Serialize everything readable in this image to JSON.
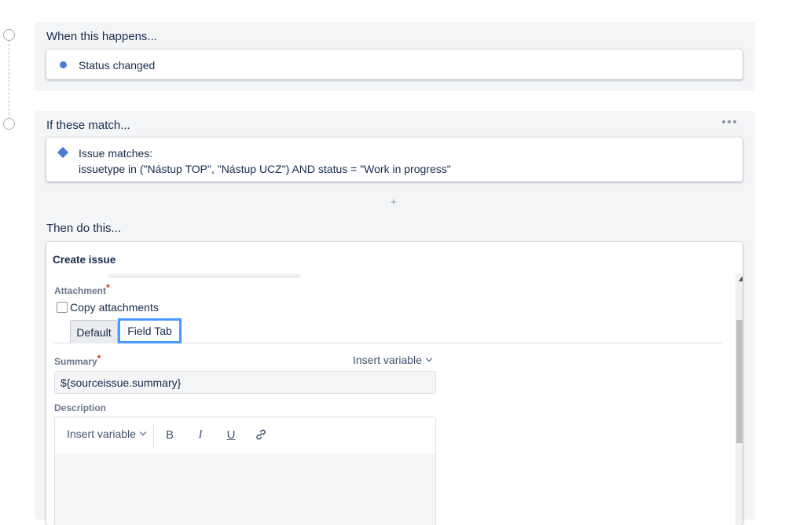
{
  "trigger": {
    "title": "When this happens...",
    "event": "Status changed"
  },
  "condition": {
    "title": "If these match...",
    "label": "Issue matches:",
    "jql": "issuetype in (\"Nástup TOP\", \"Nástup UCZ\") AND status = \"Work in progress\"",
    "more_icon": "more-horizontal-icon",
    "add_label": "+"
  },
  "action": {
    "title": "Then do this...",
    "card_title": "Create issue",
    "attachment_label": "Attachment",
    "required_marker": "*",
    "copy_attachments_label": "Copy attachments",
    "tabs": [
      {
        "label": "Default",
        "active": false
      },
      {
        "label": "Field Tab",
        "active": true
      }
    ],
    "summary_label": "Summary",
    "summary_value": "${sourceissue.summary}",
    "insert_variable": "Insert variable",
    "description_label": "Description",
    "toolbar": {
      "insert_variable": "Insert variable",
      "bold": "B",
      "italic": "I",
      "underline": "U",
      "link_icon": "link-icon"
    }
  },
  "colors": {
    "accent": "#4a7bd7",
    "focus_outline": "#4c9aff",
    "section_bg": "#f4f5f7",
    "required": "#de350b"
  }
}
